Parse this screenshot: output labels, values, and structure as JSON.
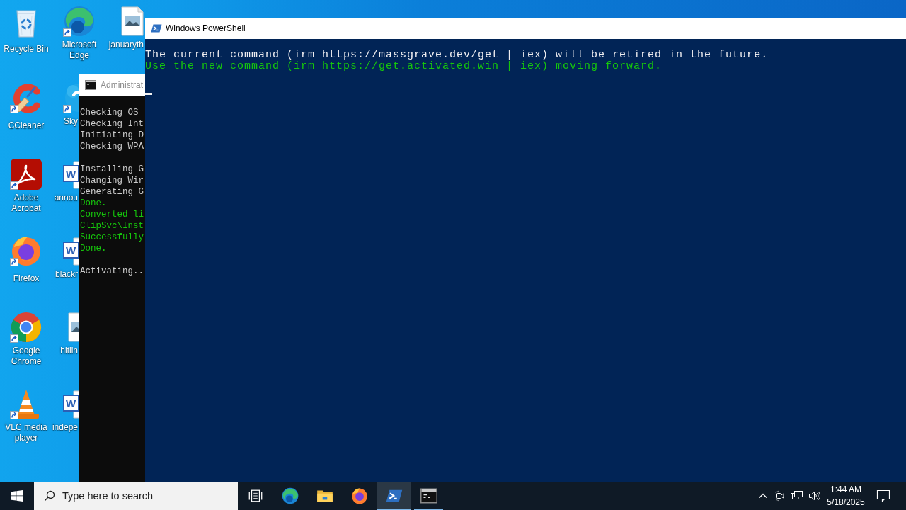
{
  "desktop": {
    "icons": [
      {
        "kind": "recycle-bin",
        "label": "Recycle Bin",
        "shortcut": false
      },
      {
        "kind": "ccleaner",
        "label": "CCleaner",
        "shortcut": true
      },
      {
        "kind": "acrobat",
        "label": "Adobe Acrobat",
        "shortcut": true
      },
      {
        "kind": "firefox",
        "label": "Firefox",
        "shortcut": true
      },
      {
        "kind": "chrome",
        "label": "Google Chrome",
        "shortcut": true
      },
      {
        "kind": "vlc",
        "label": "VLC media player",
        "shortcut": true
      },
      {
        "kind": "edge",
        "label": "Microsoft Edge",
        "shortcut": true
      },
      {
        "kind": "skype",
        "label": "Sky",
        "shortcut": true
      },
      {
        "kind": "word",
        "glyph": "W",
        "label": "annou",
        "shortcut": false
      },
      {
        "kind": "word",
        "glyph": "W",
        "label": "blackr",
        "shortcut": false
      },
      {
        "kind": "image",
        "label": "hitlin",
        "shortcut": false
      },
      {
        "kind": "word",
        "glyph": "W",
        "label": "indepe",
        "shortcut": false
      },
      {
        "kind": "image",
        "label": "januaryth",
        "shortcut": false
      }
    ]
  },
  "windows": [
    {
      "kind": "powershell",
      "title": "Windows PowerShell",
      "active": true,
      "blocks": [
        [
          {
            "text": "The current command (irm https://massgrave.dev/get | iex) will be retired in the future.",
            "color": "#eeedf0"
          },
          {
            "text": "Use the new command (irm https://get.activated.win | iex) moving forward.",
            "color": "#16c60c"
          }
        ]
      ]
    },
    {
      "kind": "cmd",
      "title": "Administrat",
      "active": false,
      "blocks": [
        [
          {
            "text": "Checking OS",
            "color": "#cccccc"
          },
          {
            "text": "Checking Int",
            "color": "#cccccc"
          },
          {
            "text": "Initiating D",
            "color": "#cccccc"
          },
          {
            "text": "Checking WPA",
            "color": "#cccccc"
          }
        ],
        [
          {
            "text": "Installing G",
            "color": "#cccccc"
          },
          {
            "text": "Changing Wir",
            "color": "#cccccc"
          },
          {
            "text": "Generating G",
            "color": "#cccccc"
          },
          {
            "text": "Done.",
            "color": "#16c60c"
          },
          {
            "text": "Converted li",
            "color": "#16c60c"
          },
          {
            "text": "ClipSvc\\Inst",
            "color": "#16c60c"
          },
          {
            "text": "Successfully",
            "color": "#16c60c"
          },
          {
            "text": "Done.",
            "color": "#16c60c"
          }
        ],
        [
          {
            "text": "Activating..",
            "color": "#cccccc"
          }
        ]
      ]
    }
  ],
  "taskbar": {
    "search": {
      "placeholder": "Type here to search"
    },
    "apps": [
      {
        "kind": "task-view",
        "running": false,
        "selected": false
      },
      {
        "kind": "edge",
        "running": false,
        "selected": false
      },
      {
        "kind": "explorer",
        "running": false,
        "selected": false
      },
      {
        "kind": "firefox",
        "running": false,
        "selected": false
      },
      {
        "kind": "powershell",
        "running": true,
        "selected": true
      },
      {
        "kind": "cmd",
        "running": true,
        "selected": false
      }
    ],
    "clock": {
      "time": "1:44 AM",
      "date": "5/18/2025"
    }
  }
}
